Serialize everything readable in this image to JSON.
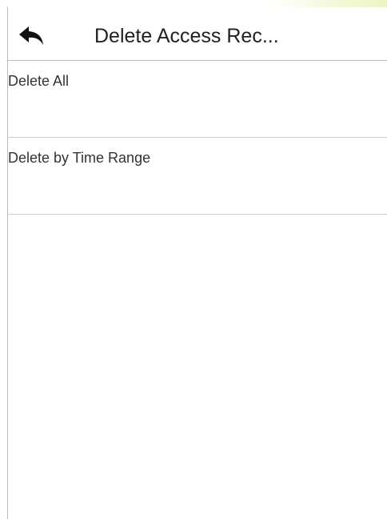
{
  "header": {
    "title": "Delete Access Rec..."
  },
  "icons": {
    "back": "back-arrow-icon"
  },
  "menu": {
    "items": [
      {
        "label": "Delete All"
      },
      {
        "label": "Delete by Time Range"
      }
    ]
  },
  "colors": {
    "divider": "#bdbdbd",
    "text": "#333333",
    "background": "#ffffff"
  }
}
